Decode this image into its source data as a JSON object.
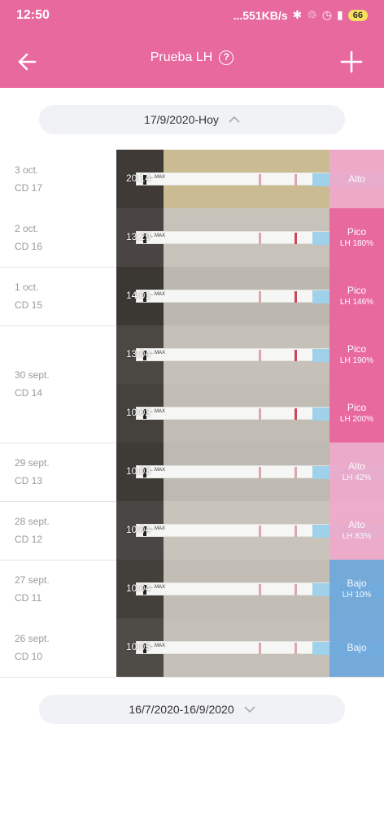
{
  "status_bar": {
    "time": "12:50",
    "network_speed": "...551KB/s",
    "battery": "66",
    "icons": [
      "bluetooth-icon",
      "mute-icon",
      "alarm-icon",
      "signal-icon"
    ]
  },
  "header": {
    "title": "Prueba LH",
    "help_symbol": "?",
    "back_icon": "back-arrow-icon",
    "add_icon": "plus-icon"
  },
  "range_top": {
    "label": "17/9/2020-Hoy",
    "icon": "chevron-up-icon"
  },
  "range_bottom": {
    "label": "16/7/2020-16/9/2020",
    "icon": "chevron-down-icon"
  },
  "colors": {
    "brand": "#e8699e",
    "pico": "#e8699e",
    "alto": "#efa9cb",
    "bajo": "#6fa8dc"
  },
  "days": [
    {
      "date": "3 oct.",
      "cd": "CD 17",
      "tests": [
        {
          "time": "20:14",
          "status": "Alto",
          "value": "",
          "level": "alto"
        }
      ]
    },
    {
      "date": "2 oct.",
      "cd": "CD 16",
      "tests": [
        {
          "time": "13:29",
          "status": "Pico",
          "value": "LH 180%",
          "level": "pico"
        }
      ]
    },
    {
      "date": "1 oct.",
      "cd": "CD 15",
      "tests": [
        {
          "time": "14:01",
          "status": "Pico",
          "value": "LH 146%",
          "level": "pico"
        }
      ]
    },
    {
      "date": "30 sept.",
      "cd": "CD 14",
      "tests": [
        {
          "time": "13:04",
          "status": "Pico",
          "value": "LH 190%",
          "level": "pico"
        },
        {
          "time": "10:02",
          "status": "Pico",
          "value": "LH 200%",
          "level": "pico"
        }
      ]
    },
    {
      "date": "29 sept.",
      "cd": "CD 13",
      "tests": [
        {
          "time": "10:03",
          "status": "Alto",
          "value": "LH 42%",
          "level": "alto"
        }
      ]
    },
    {
      "date": "28 sept.",
      "cd": "CD 12",
      "tests": [
        {
          "time": "10:04",
          "status": "Alto",
          "value": "LH 83%",
          "level": "alto"
        }
      ]
    },
    {
      "date": "27 sept.",
      "cd": "CD 11",
      "tests": [
        {
          "time": "10:04",
          "status": "Bajo",
          "value": "LH 10%",
          "level": "bajo"
        }
      ]
    },
    {
      "date": "26 sept.",
      "cd": "CD 10",
      "tests": [
        {
          "time": "10:05",
          "status": "Bajo",
          "value": "",
          "level": "bajo"
        }
      ]
    }
  ],
  "strip_text": {
    "max": "MAX",
    "lh": "LH"
  }
}
